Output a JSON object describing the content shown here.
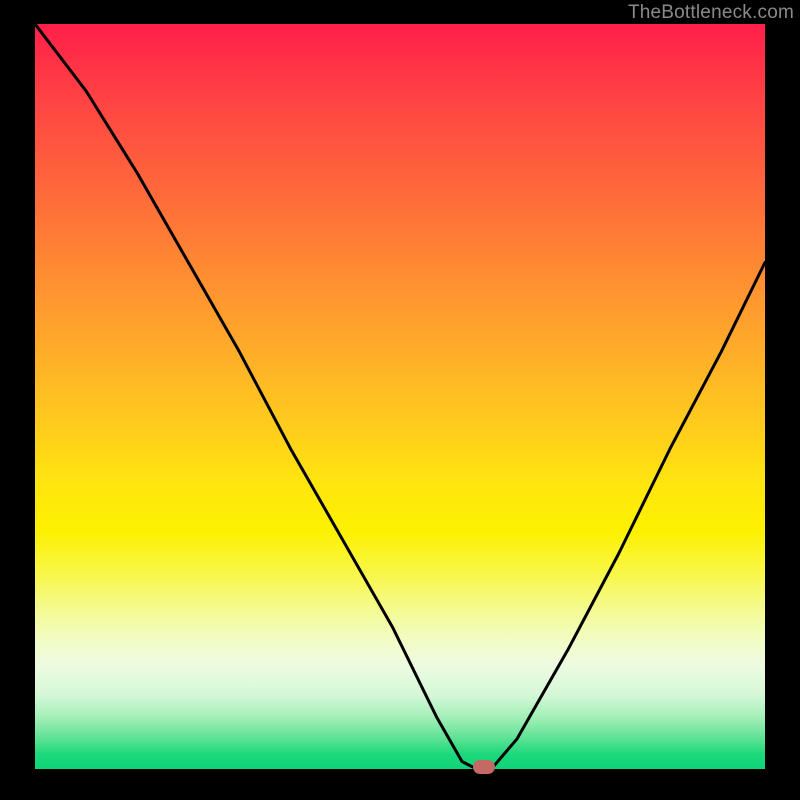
{
  "watermark": "TheBottleneck.com",
  "chart_data": {
    "type": "line",
    "title": "",
    "xlabel": "",
    "ylabel": "",
    "xlim": [
      0,
      100
    ],
    "ylim": [
      0,
      100
    ],
    "x": [
      0,
      7,
      14,
      21,
      28,
      35,
      42,
      49,
      55,
      58.5,
      60.5,
      62.5,
      66,
      73,
      80,
      87,
      94,
      100
    ],
    "values": [
      100,
      91,
      80,
      68,
      56,
      43,
      31,
      19,
      7,
      1,
      0,
      0,
      4,
      16,
      29,
      43,
      56,
      68
    ],
    "marker": {
      "x": 61.5,
      "y": 0
    },
    "gradient_colors": {
      "top": "#ff1f4a",
      "mid": "#ffe60e",
      "bottom": "#0dd677"
    }
  }
}
